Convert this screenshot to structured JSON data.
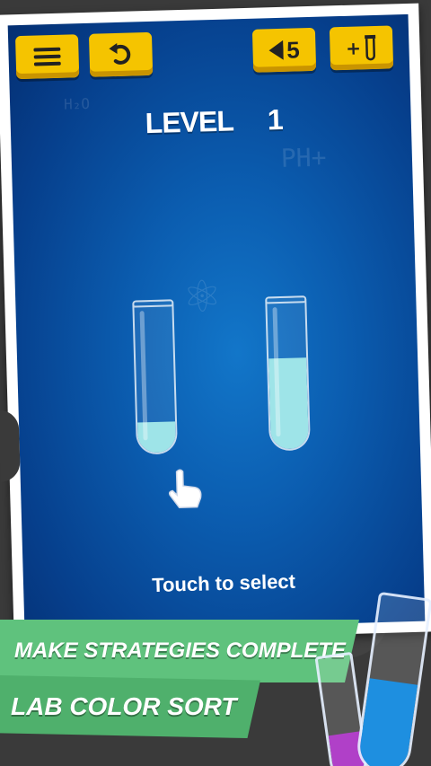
{
  "toolbar": {
    "menu_icon": "hamburger-menu-icon",
    "undo_icon": "undo-icon",
    "undo_count": "5",
    "add_tube_label": "+"
  },
  "level": {
    "label": "LEVEL",
    "number": "1"
  },
  "tubes": [
    {
      "liquid_color": "#9ee4e8",
      "fill_fraction": 0.2
    },
    {
      "liquid_color": "#9ee4e8",
      "fill_fraction": 0.6
    }
  ],
  "hint": {
    "text": "Touch to select"
  },
  "promo": {
    "line1": "MAKE STRATEGIES COMPLETE",
    "line2": "LAB COLOR SORT"
  },
  "colors": {
    "button": "#f5c400",
    "screen": "#0b5db0",
    "banner": "#5fc27d",
    "liquid": "#9ee4e8",
    "deco_purple": "#b040c8",
    "deco_blue": "#1e8fe0"
  }
}
